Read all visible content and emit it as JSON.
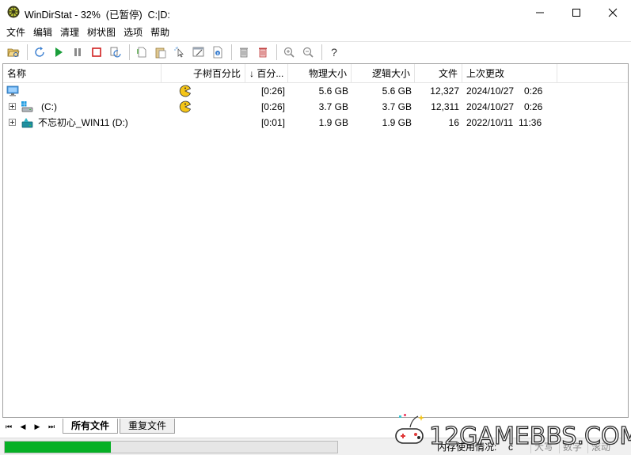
{
  "window": {
    "title": "WinDirStat - 32%  (已暂停)  C:|D:",
    "controls": [
      "minimize",
      "maximize",
      "close"
    ]
  },
  "menu": {
    "items": [
      "文件",
      "编辑",
      "清理",
      "树状图",
      "选项",
      "帮助"
    ]
  },
  "toolbar": {
    "buttons": [
      "open-folder-icon",
      "refresh-icon",
      "play-icon",
      "pause-icon",
      "stop-icon",
      "refresh-selected-icon",
      "copy-path-icon",
      "paste-icon",
      "explorer-icon",
      "command-prompt-icon",
      "properties-icon",
      "delete-recycle-icon",
      "delete-permanent-icon",
      "zoom-in-icon",
      "zoom-out-icon",
      "help-icon"
    ],
    "help_label": "?"
  },
  "columns": {
    "name": "名称",
    "subtree_percent": "子树百分比",
    "percent": "↓ 百分...",
    "physical_size": "物理大小",
    "logical_size": "逻辑大小",
    "files": "文件",
    "last_modified": "上次更改"
  },
  "rows": [
    {
      "name": "",
      "icon": "computer-icon",
      "time": "[0:26]",
      "physical": "5.6 GB",
      "logical": "5.6 GB",
      "files": "12,327",
      "date": "2024/10/27",
      "clock": "0:26",
      "expandable": false
    },
    {
      "name": "(C:)",
      "icon": "drive-c-icon",
      "time": "[0:26]",
      "physical": "3.7 GB",
      "logical": "3.7 GB",
      "files": "12,311",
      "date": "2024/10/27",
      "clock": "0:26",
      "expandable": true
    },
    {
      "name": "不忘初心_WIN11 (D:)",
      "icon": "drive-d-icon",
      "time": "[0:01]",
      "physical": "1.9 GB",
      "logical": "1.9 GB",
      "files": "16",
      "date": "2022/10/11",
      "clock": "11:36",
      "expandable": true
    }
  ],
  "tabs": {
    "nav": [
      "⏮",
      "◀",
      "▶",
      "⏭"
    ],
    "all_files": "所有文件",
    "duplicate_files": "重复文件"
  },
  "status": {
    "progress_fraction": 0.32,
    "memory_label": "内存使用情况:",
    "memory_value": "c",
    "caps": "大写",
    "num": "数字",
    "scroll": "滚动"
  },
  "watermark": {
    "text": "12GAMEBBS.COM"
  },
  "colors": {
    "progress": "#06b025",
    "pacman": "#f5c518"
  }
}
